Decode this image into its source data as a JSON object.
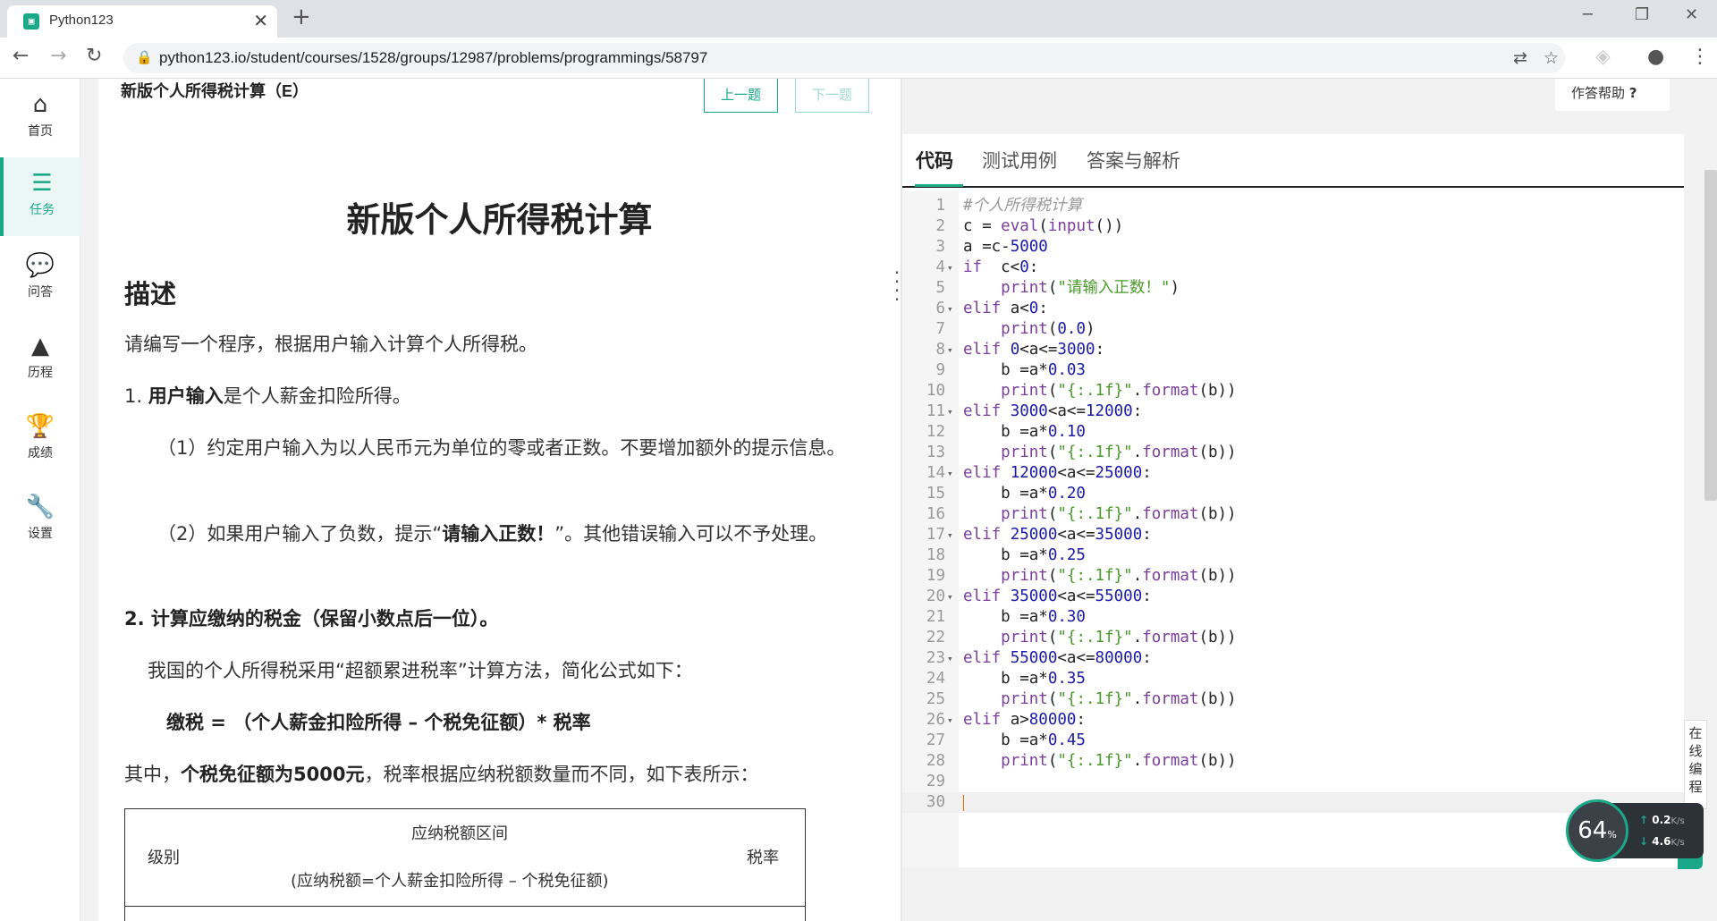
{
  "browser": {
    "tab_title": "Python123",
    "tab_close": "✕",
    "new_tab": "+",
    "url": "python123.io/student/courses/1528/groups/12987/problems/programmings/58797"
  },
  "nav": {
    "items": [
      {
        "label": "首页",
        "icon": "home-icon"
      },
      {
        "label": "任务",
        "icon": "tasks-icon"
      },
      {
        "label": "问答",
        "icon": "chat-icon"
      },
      {
        "label": "历程",
        "icon": "tree-icon"
      },
      {
        "label": "成绩",
        "icon": "trophy-icon"
      },
      {
        "label": "设置",
        "icon": "wrench-icon"
      }
    ]
  },
  "problem": {
    "header": "新版个人所得税计算（E）",
    "prev_label": "上一题",
    "next_label": "下一题",
    "title": "新版个人所得税计算",
    "section_desc": "描述",
    "p1": "请编写一个程序，根据用户输入计算个人所得税。",
    "p2_prefix": "1. ",
    "p2_bold": "用户输入",
    "p2_rest": "是个人薪金扣险所得。",
    "p3": "（1）约定用户输入为以人民币元为单位的零或者正数。不要增加额外的提示信息。",
    "p4_a": "（2）如果用户输入了负数，提示“",
    "p4_bold": "请输入正数！",
    "p4_b": "”。其他错误输入可以不予处理。",
    "p5_bold": "2. 计算应缴纳的税金（保留小数点后一位）。",
    "p6": "我国的个人所得税采用“超额累进税率”计算方法，简化公式如下：",
    "p7_bold": "缴税 = （个人薪金扣险所得 – 个税免征额）* 税率",
    "p8_a": "其中，",
    "p8_bold": "个税免征额为5000元",
    "p8_b": "，税率根据应纳税额数量而不同，如下表所示：",
    "table": {
      "col1": "级别",
      "col2_line1": "应纳税额区间",
      "col2_line2": "(应纳税额=个人薪金扣险所得 – 个税免征额)",
      "col3": "税率"
    }
  },
  "editor": {
    "help_label": "作答帮助",
    "tabs": [
      "代码",
      "测试用例",
      "答案与解析"
    ],
    "lines": [
      "#个人所得税计算",
      "c = eval(input())",
      "a =c-5000",
      "if  c<0:",
      "    print(\"请输入正数！\")",
      "elif a<0:",
      "    print(0.0)",
      "elif 0<a<=3000:",
      "    b =a*0.03",
      "    print(\"{:.1f}\".format(b))",
      "elif 3000<a<=12000:",
      "    b =a*0.10",
      "    print(\"{:.1f}\".format(b))",
      "elif 12000<a<=25000:",
      "    b =a*0.20",
      "    print(\"{:.1f}\".format(b))",
      "elif 25000<a<=35000:",
      "    b =a*0.25",
      "    print(\"{:.1f}\".format(b))",
      "elif 35000<a<=55000:",
      "    b =a*0.30",
      "    print(\"{:.1f}\".format(b))",
      "elif 55000<a<=80000:",
      "    b =a*0.35",
      "    print(\"{:.1f}\".format(b))",
      "elif a>80000:",
      "    b =a*0.45",
      "    print(\"{:.1f}\".format(b))",
      "",
      ""
    ],
    "fold_lines": [
      4,
      6,
      8,
      11,
      14,
      17,
      20,
      23,
      26
    ],
    "current_line": 30
  },
  "widgets": {
    "online_label": "在线编程",
    "net_percent": "64",
    "net_percent_unit": "%",
    "up_speed": "0.2",
    "down_speed": "4.6",
    "speed_unit": "K/s"
  },
  "colors": {
    "accent": "#1aa889",
    "keyword": "#7a3e9d",
    "string": "#4a9a2a",
    "number": "#1a1aa6",
    "comment": "#999999"
  }
}
